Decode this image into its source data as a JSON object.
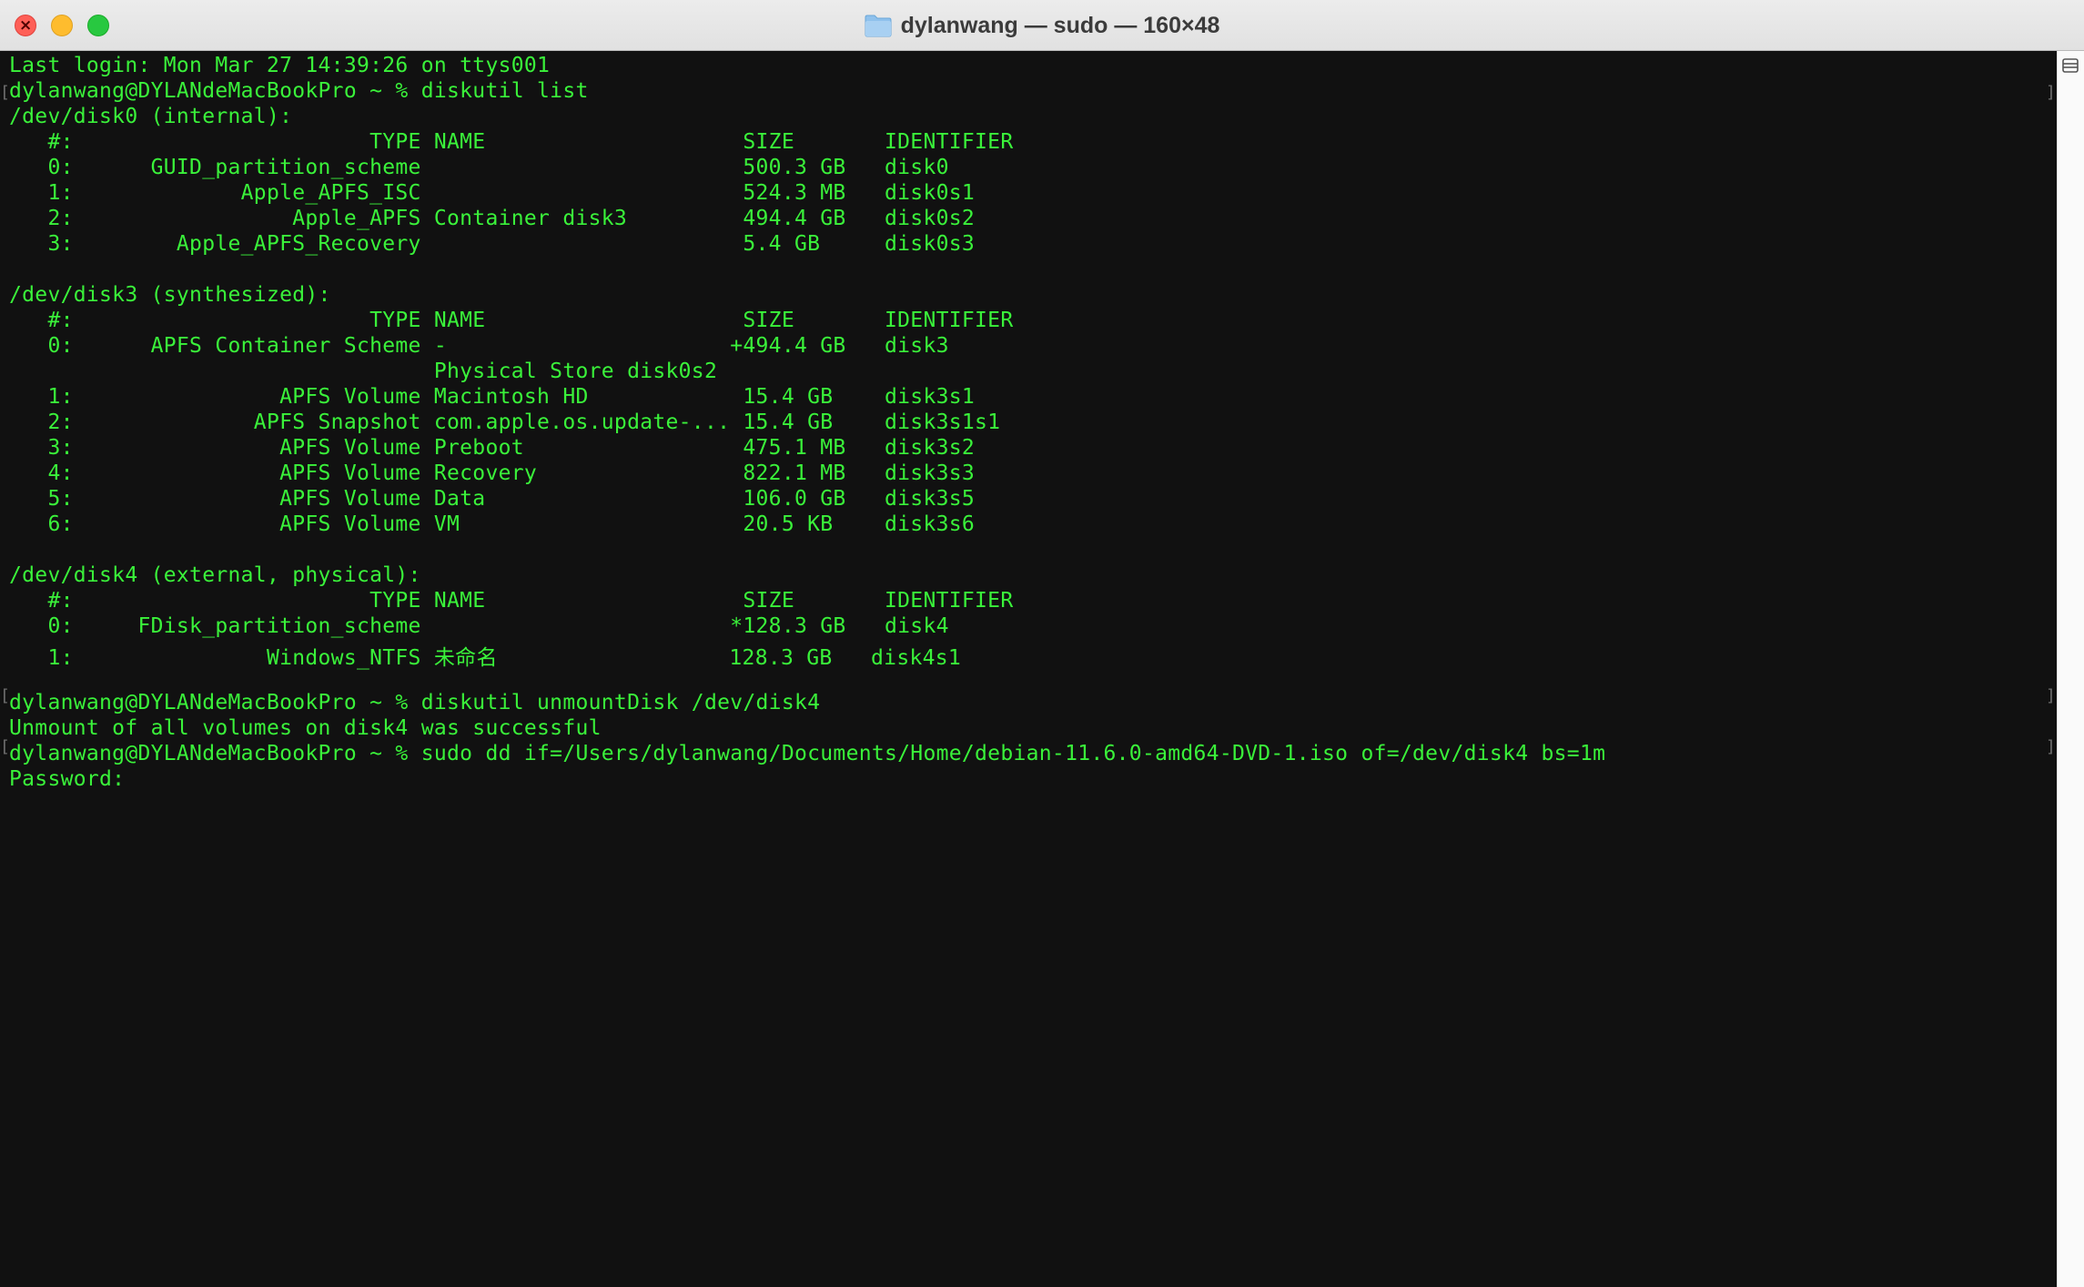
{
  "window": {
    "title": "dylanwang — sudo — 160×48",
    "folder_icon": "folder-icon",
    "close_glyph": "×"
  },
  "terminal": {
    "lines": [
      "Last login: Mon Mar 27 14:39:26 on ttys001",
      "dylanwang@DYLANdeMacBookPro ~ % diskutil list",
      "/dev/disk0 (internal):",
      "   #:                       TYPE NAME                    SIZE       IDENTIFIER",
      "   0:      GUID_partition_scheme                         500.3 GB   disk0",
      "   1:             Apple_APFS_ISC                         524.3 MB   disk0s1",
      "   2:                 Apple_APFS Container disk3         494.4 GB   disk0s2",
      "   3:        Apple_APFS_Recovery                         5.4 GB     disk0s3",
      "",
      "/dev/disk3 (synthesized):",
      "   #:                       TYPE NAME                    SIZE       IDENTIFIER",
      "   0:      APFS Container Scheme -                      +494.4 GB   disk3",
      "                                 Physical Store disk0s2",
      "   1:                APFS Volume Macintosh HD            15.4 GB    disk3s1",
      "   2:              APFS Snapshot com.apple.os.update-... 15.4 GB    disk3s1s1",
      "   3:                APFS Volume Preboot                 475.1 MB   disk3s2",
      "   4:                APFS Volume Recovery                822.1 MB   disk3s3",
      "   5:                APFS Volume Data                    106.0 GB   disk3s5",
      "   6:                APFS Volume VM                      20.5 KB    disk3s6",
      "",
      "/dev/disk4 (external, physical):",
      "   #:                       TYPE NAME                    SIZE       IDENTIFIER",
      "   0:     FDisk_partition_scheme                        *128.3 GB   disk4",
      "   1:               Windows_NTFS 未命名                  128.3 GB   disk4s1",
      "",
      "dylanwang@DYLANdeMacBookPro ~ % diskutil unmountDisk /dev/disk4",
      "Unmount of all volumes on disk4 was successful",
      "dylanwang@DYLANdeMacBookPro ~ % sudo dd if=/Users/dylanwang/Documents/Home/debian-11.6.0-amd64-DVD-1.iso of=/dev/disk4 bs=1m",
      "Password:"
    ]
  },
  "colors": {
    "terminal_bg": "#111111",
    "terminal_text": "#3af23a",
    "titlebar_bg": "#e6e6e6"
  },
  "scrollbar": {
    "split_icon": "split-pane-icon"
  }
}
